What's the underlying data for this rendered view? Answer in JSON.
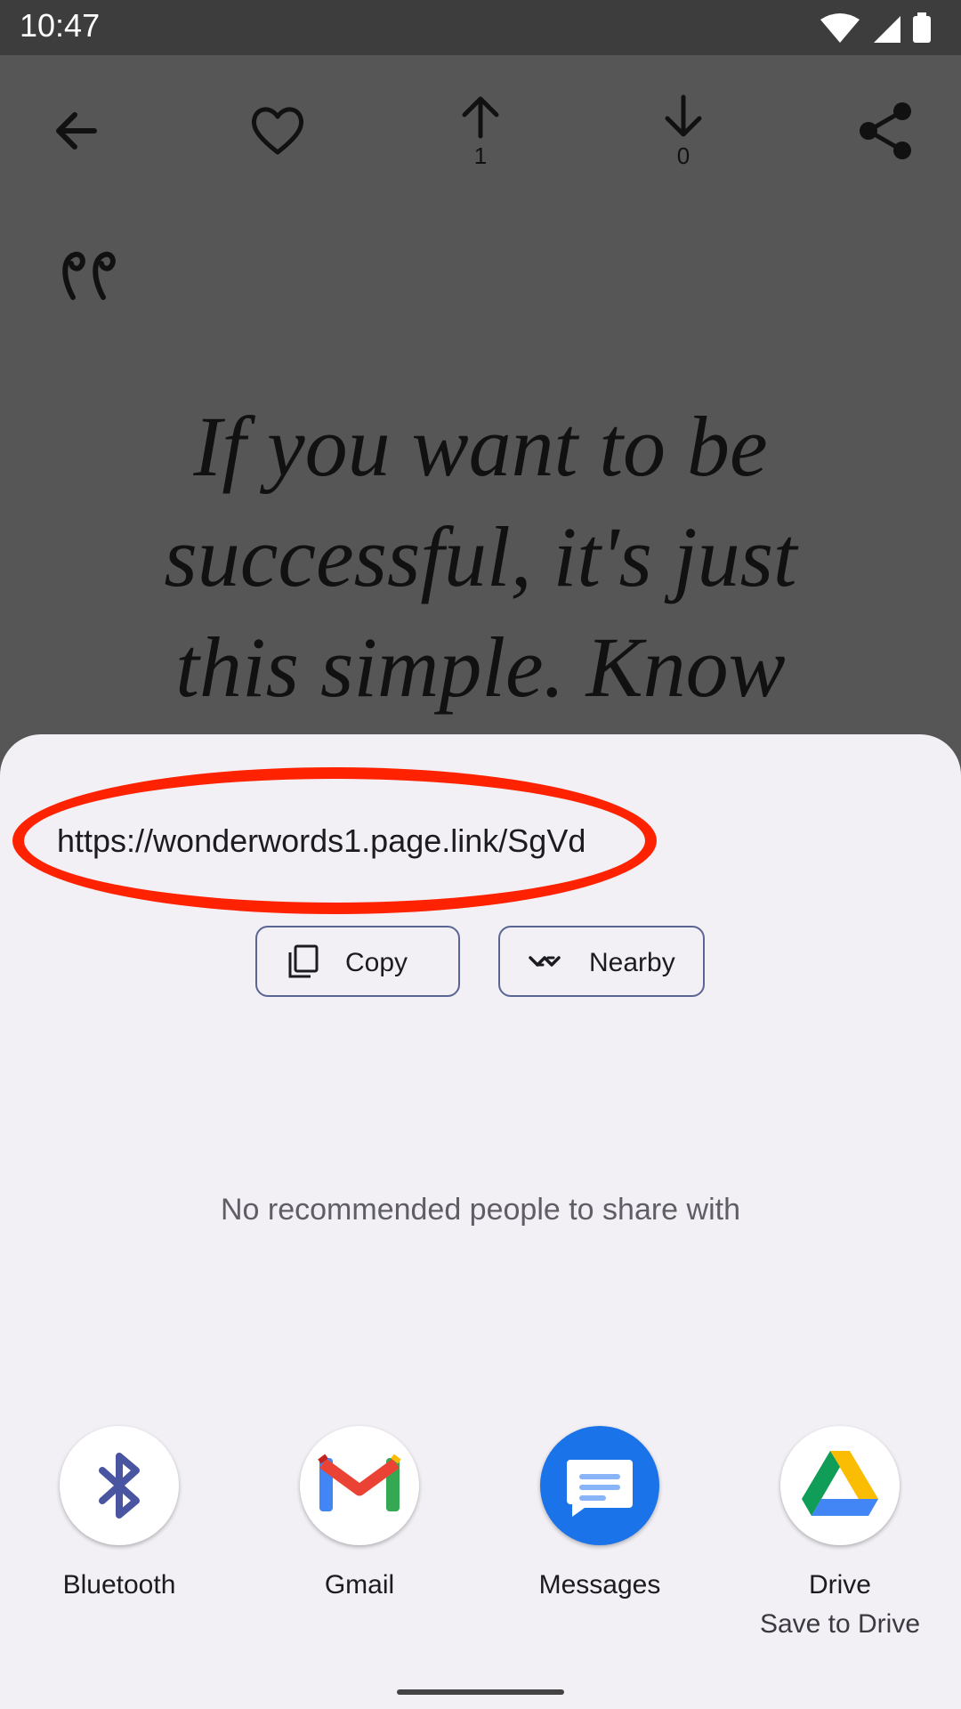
{
  "status_bar": {
    "time": "10:47"
  },
  "toolbar": {
    "upvote_count": "1",
    "downvote_count": "0"
  },
  "quote": {
    "text": "If you want to be successful, it's just this simple. Know"
  },
  "share_sheet": {
    "url": "https://wonderwords1.page.link/SgVd",
    "copy_label": "Copy",
    "nearby_label": "Nearby",
    "empty_people_text": "No recommended people to share with",
    "targets": [
      {
        "label": "Bluetooth",
        "icon": "bluetooth-icon"
      },
      {
        "label": "Gmail",
        "icon": "gmail-icon"
      },
      {
        "label": "Messages",
        "icon": "messages-icon"
      },
      {
        "label": "Drive",
        "sublabel": "Save to Drive",
        "icon": "drive-icon"
      }
    ]
  },
  "colors": {
    "highlight_ellipse": "#ff2200",
    "sheet_bg": "#f2f0f5",
    "messages_blue": "#1a73e8",
    "bluetooth_purple": "#4a55a2"
  }
}
